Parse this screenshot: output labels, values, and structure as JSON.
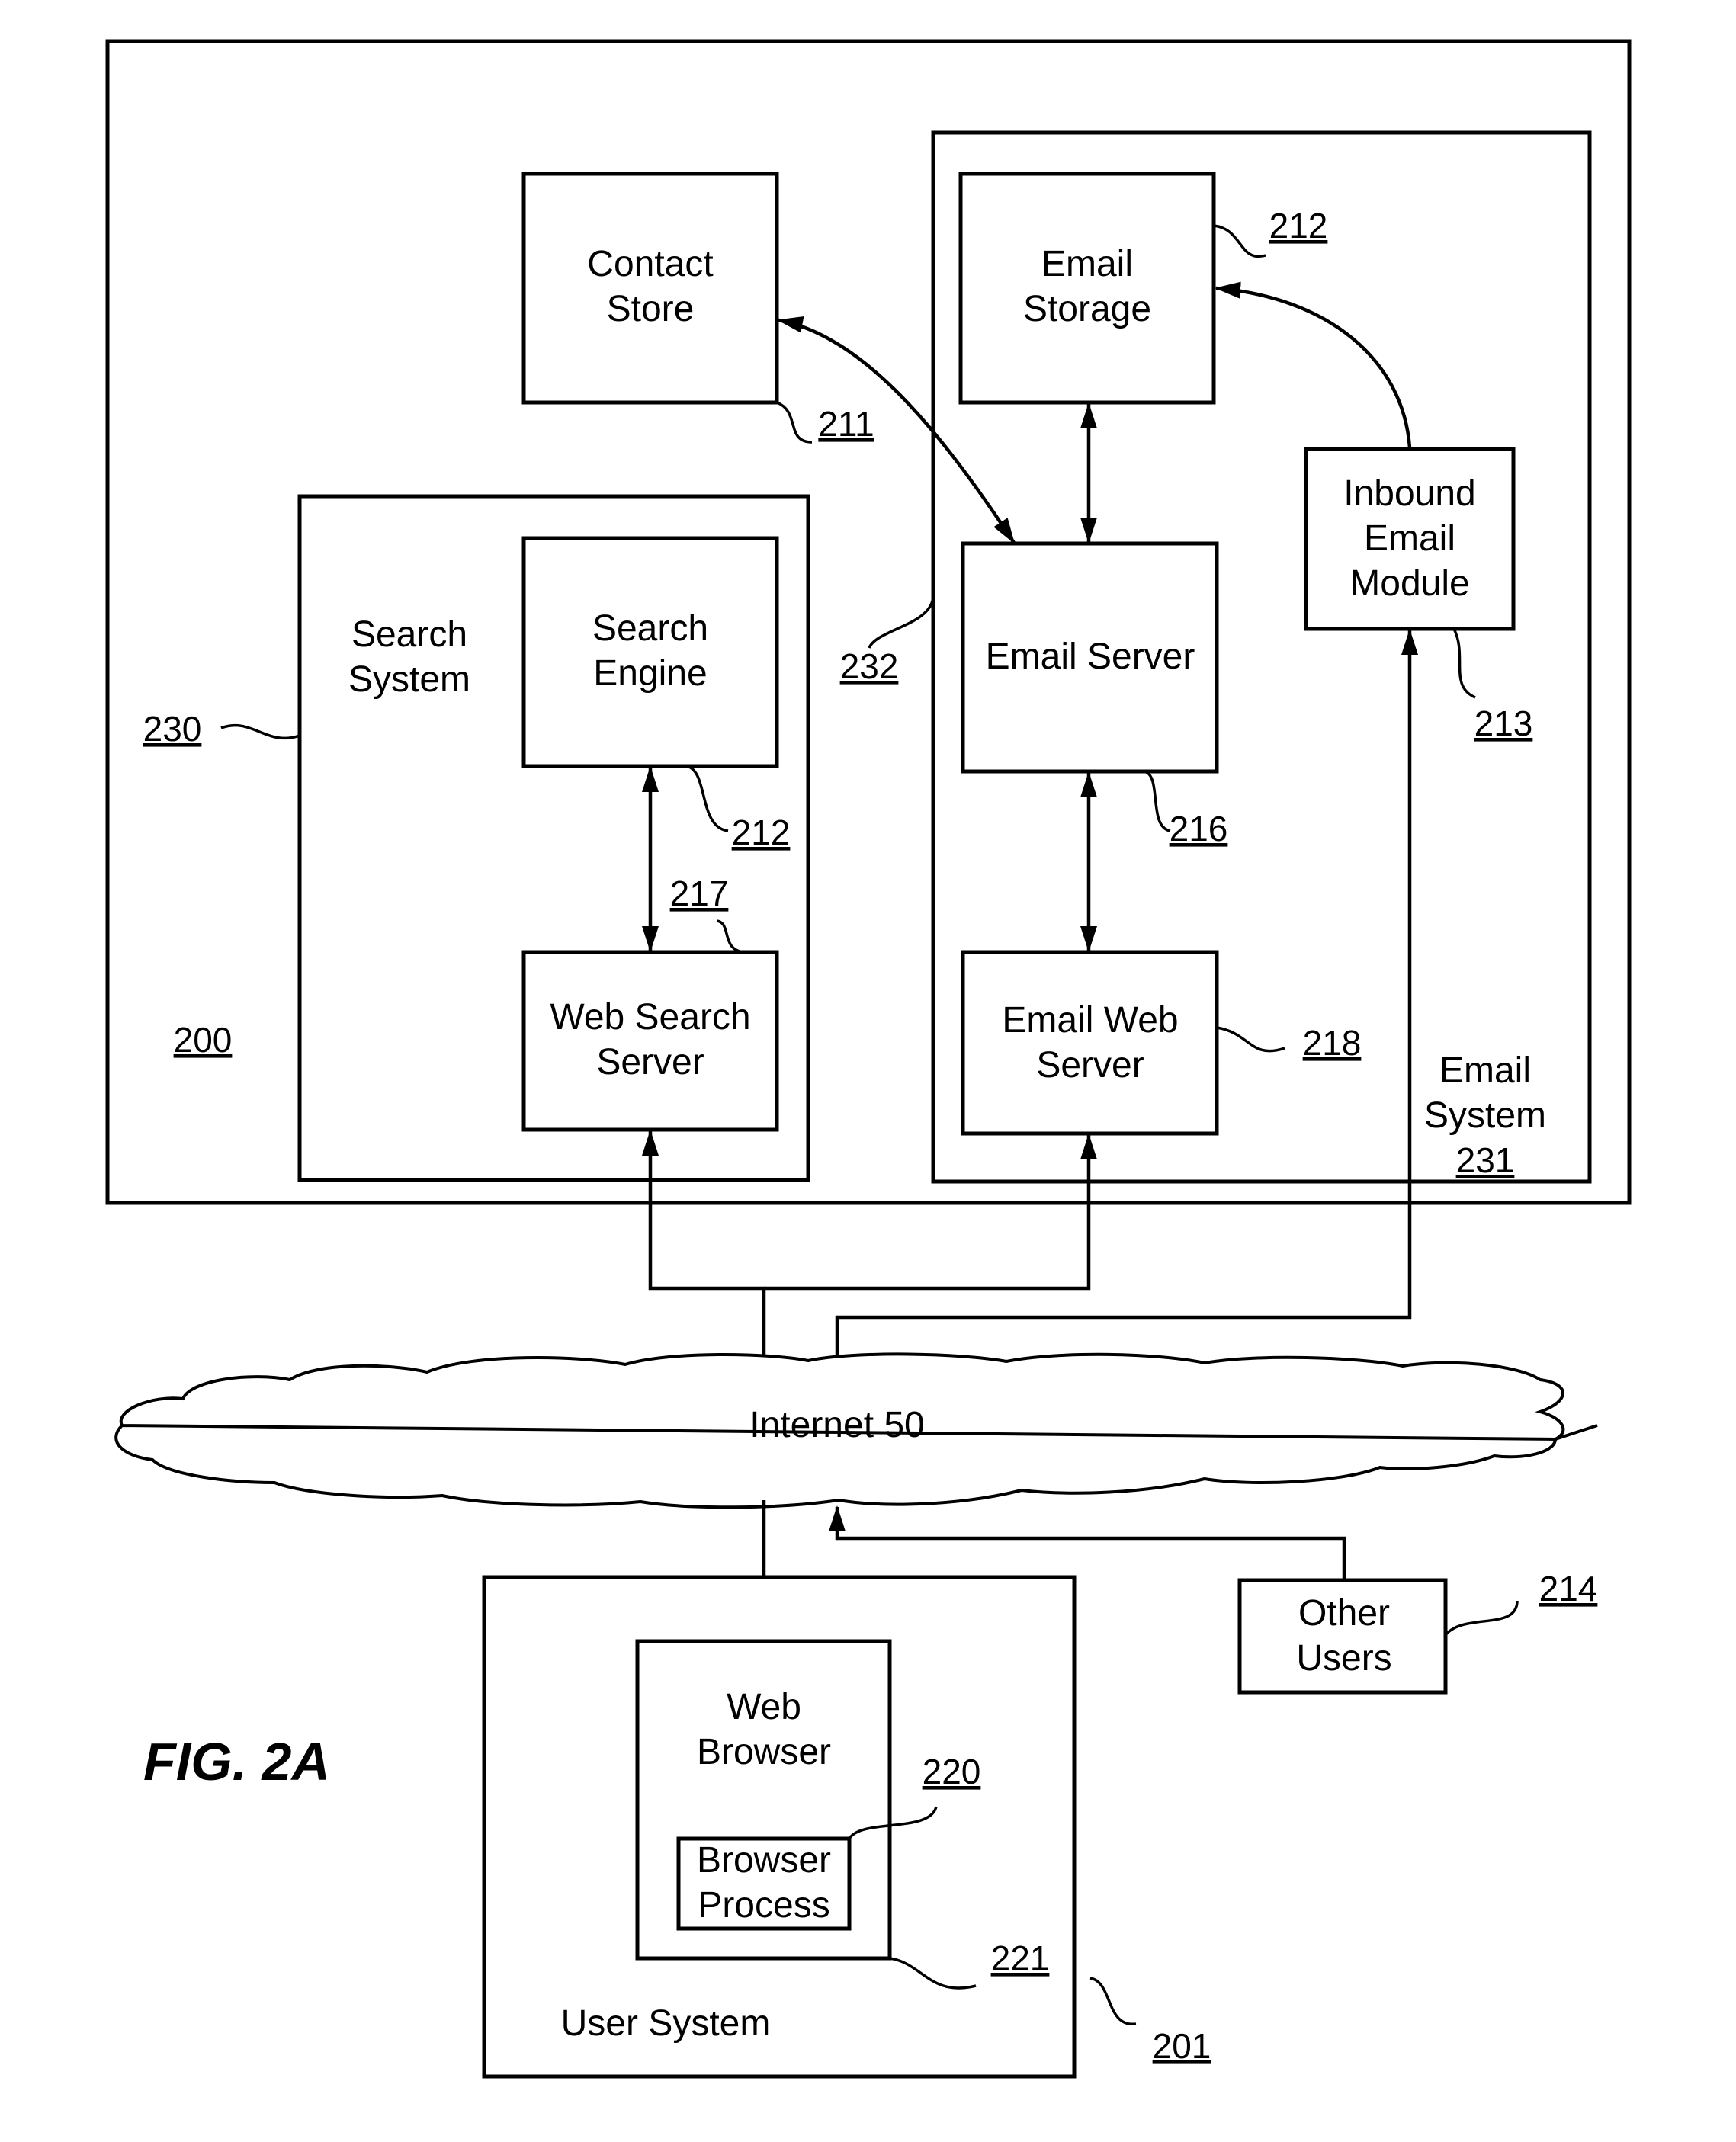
{
  "figure": {
    "title": "FIG. 2A",
    "system_ref": "200"
  },
  "nodes": {
    "contact_store": {
      "lines": [
        "Contact",
        "Store"
      ],
      "ref": "211"
    },
    "email_storage": {
      "lines": [
        "Email",
        "Storage"
      ],
      "ref": "212"
    },
    "inbound_email_module": {
      "lines": [
        "Inbound",
        "Email",
        "Module"
      ],
      "ref": "213"
    },
    "search_system": {
      "lines": [
        "Search",
        "System"
      ],
      "ref": "230"
    },
    "search_engine": {
      "lines": [
        "Search",
        "Engine"
      ],
      "ref": "212"
    },
    "web_search_server": {
      "lines": [
        "Web Search",
        "Server"
      ],
      "ref": "217"
    },
    "email_server": {
      "lines": [
        "Email Server"
      ],
      "ref": "216"
    },
    "email_web_server": {
      "lines": [
        "Email Web",
        "Server"
      ],
      "ref": "218"
    },
    "email_system": {
      "lines": [
        "Email",
        "System"
      ],
      "ref": "231"
    },
    "contact_link_ref": "232",
    "internet": {
      "label": "Internet 50"
    },
    "user_system": {
      "label": "User System",
      "ref": "201"
    },
    "web_browser": {
      "lines": [
        "Web",
        "Browser"
      ],
      "ref": "221"
    },
    "browser_process": {
      "lines": [
        "Browser",
        "Process"
      ],
      "ref": "220"
    },
    "other_users": {
      "lines": [
        "Other",
        "Users"
      ],
      "ref": "214"
    }
  }
}
